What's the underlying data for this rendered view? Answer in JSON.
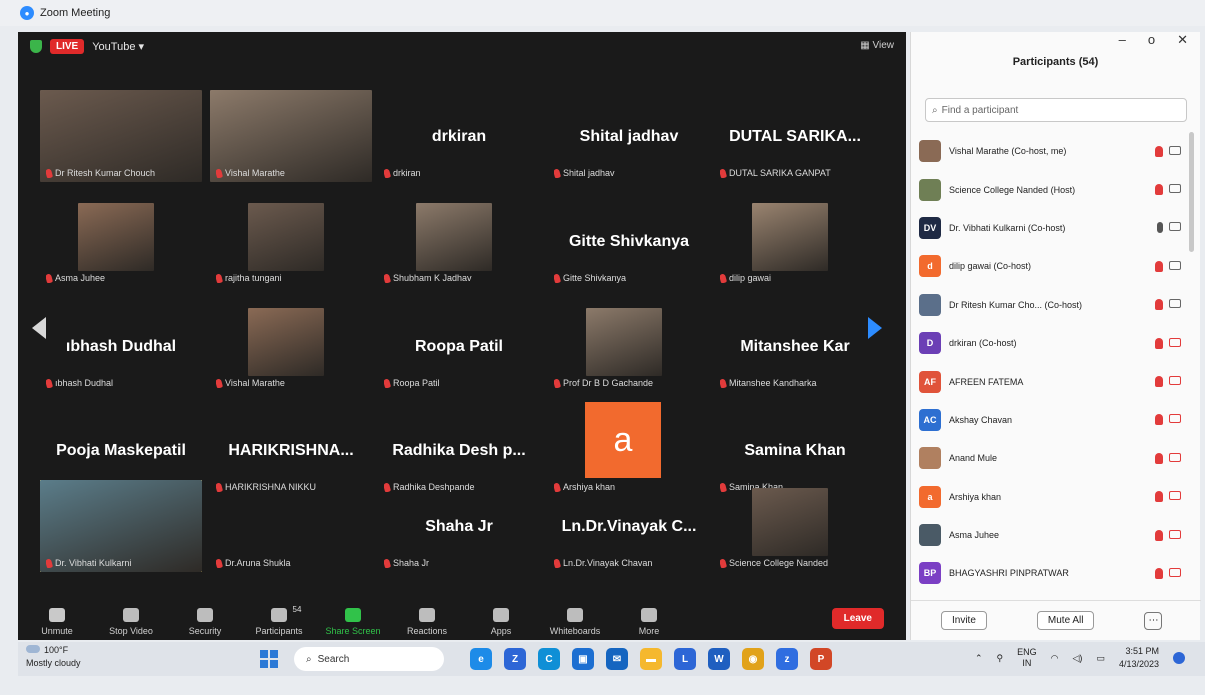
{
  "window": {
    "title": "Zoom Meeting"
  },
  "topbar": {
    "live": "LIVE",
    "youtube": "YouTube",
    "view": "View"
  },
  "tiles": [
    {
      "name": "Dr Ritesh Kumar Chouch",
      "video": true
    },
    {
      "name": "Vishal Marathe",
      "video": true
    },
    {
      "big": "drkiran",
      "name": "drkiran"
    },
    {
      "big": "Shital jadhav",
      "name": "Shital jadhav"
    },
    {
      "big": "DUTAL SARIKA...",
      "name": "DUTAL SARIKA GANPAT"
    },
    {
      "name": "Asma Juhee",
      "video": true
    },
    {
      "name": "rajitha tungani",
      "video": true
    },
    {
      "name": "Shubham K Jadhav",
      "video": true
    },
    {
      "big": "Gitte Shivkanya",
      "name": "Gitte Shivkanya"
    },
    {
      "name": "dilip gawai",
      "video": true
    },
    {
      "big": "ıbhash Dudhal",
      "name": "ıbhash Dudhal"
    },
    {
      "name": "Vishal Marathe",
      "video": true
    },
    {
      "big": "Roopa Patil",
      "name": "Roopa Patil"
    },
    {
      "name": "Prof Dr B D Gachande",
      "video": true
    },
    {
      "big": "Mitanshee Kar",
      "name": "Mitanshee Kandharka"
    },
    {
      "big": "Pooja Maskepatil",
      "name": "Pooja Maskepatil"
    },
    {
      "big": "HARIKRISHNA...",
      "name": "HARIKRISHNA NIKKU"
    },
    {
      "big": "Radhika Desh p...",
      "name": "Radhika Deshpande"
    },
    {
      "name": "Arshiya khan",
      "avatar": "a"
    },
    {
      "big": "Samina Khan",
      "name": "Samina Khan"
    },
    {
      "name": "Dr. Vibhati Kulkarni",
      "video": true
    },
    {
      "name": "Dr.Aruna Shukla"
    },
    {
      "big": "Shaha Jr",
      "name": "Shaha Jr"
    },
    {
      "big": "Ln.Dr.Vinayak C...",
      "name": "Ln.Dr.Vinayak Chavan"
    },
    {
      "name": "Science College Nanded",
      "video": true
    }
  ],
  "toolbar": {
    "items": [
      {
        "label": "Unmute",
        "icon": "mic-off-icon"
      },
      {
        "label": "Stop Video",
        "icon": "video-icon"
      },
      {
        "label": "Security",
        "icon": "shield-icon"
      },
      {
        "label": "Participants",
        "icon": "participants-icon",
        "count": "54"
      },
      {
        "label": "Share Screen",
        "icon": "share-screen-icon"
      },
      {
        "label": "Reactions",
        "icon": "reactions-icon"
      },
      {
        "label": "Apps",
        "icon": "apps-icon"
      },
      {
        "label": "Whiteboards",
        "icon": "whiteboard-icon"
      },
      {
        "label": "More",
        "icon": "more-icon"
      }
    ],
    "leave": "Leave"
  },
  "panel": {
    "title": "Participants (54)",
    "search_placeholder": "Find a participant",
    "participants": [
      {
        "name": "Vishal Marathe (Co-host, me)",
        "initials": "",
        "color": "#8a6a55"
      },
      {
        "name": "Science College Nanded (Host)",
        "initials": "",
        "color": "#6f7f55"
      },
      {
        "name": "Dr. Vibhati Kulkarni (Co-host)",
        "initials": "DV",
        "color": "#1f2a44"
      },
      {
        "name": "dilip gawai (Co-host)",
        "initials": "d",
        "color": "#f26a2e"
      },
      {
        "name": "Dr Ritesh Kumar Cho... (Co-host)",
        "initials": "",
        "color": "#5b6f8a"
      },
      {
        "name": "drkiran (Co-host)",
        "initials": "D",
        "color": "#6b3fb5"
      },
      {
        "name": "AFREEN FATEMA",
        "initials": "AF",
        "color": "#e0533a"
      },
      {
        "name": "Akshay Chavan",
        "initials": "AC",
        "color": "#2d6fd1"
      },
      {
        "name": "Anand Mule",
        "initials": "",
        "color": "#b08060"
      },
      {
        "name": "Arshiya khan",
        "initials": "a",
        "color": "#f26a2e"
      },
      {
        "name": "Asma Juhee",
        "initials": "",
        "color": "#4a5a66"
      },
      {
        "name": "BHAGYASHRI PINPRATWAR",
        "initials": "BP",
        "color": "#7b3fc4"
      }
    ],
    "invite": "Invite",
    "mute_all": "Mute All"
  },
  "taskbar": {
    "weather_temp": "100°F",
    "weather_text": "Mostly cloudy",
    "search": "Search",
    "lang": "ENG",
    "region": "IN",
    "time": "3:51 PM",
    "date": "4/13/2023"
  }
}
